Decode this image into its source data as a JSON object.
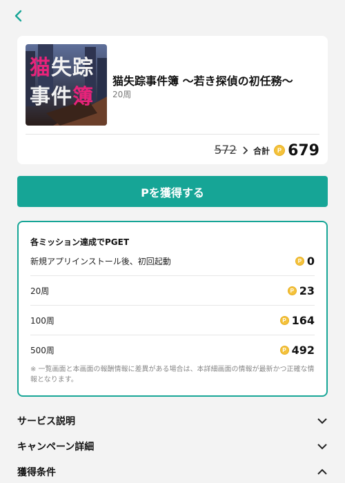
{
  "nav": {
    "back_icon": "chevron-left-icon"
  },
  "product": {
    "title": "猫失踪事件簿 〜若き探偵の初任務〜",
    "subtitle": "20周",
    "thumb_line1": [
      "猫",
      "失",
      "踪"
    ],
    "thumb_line2": [
      "事",
      "件",
      "簿"
    ],
    "old_price": "572",
    "total_label": "合計",
    "total": "679"
  },
  "cta": {
    "label": "Pを獲得する"
  },
  "mission": {
    "title": "各ミッション達成でPGET",
    "rows": [
      {
        "label": "新規アプリインストール後、初回起動",
        "value": "0"
      },
      {
        "label": "20周",
        "value": "23"
      },
      {
        "label": "100周",
        "value": "164"
      },
      {
        "label": "500周",
        "value": "492"
      }
    ],
    "note": "※ 一覧画面と本画面の報酬情報に差異がある場合は、本詳細画面の情報が最新かつ正確な情報となります。"
  },
  "coin_letter": "P",
  "accordions": [
    {
      "label": "サービス説明",
      "icon": "chevron-down-icon"
    },
    {
      "label": "キャンペーン詳細",
      "icon": "chevron-down-icon"
    },
    {
      "label": "獲得条件",
      "icon": "chevron-up-icon"
    }
  ],
  "colors": {
    "accent": "#16a596",
    "coin": "#f4c23b",
    "thumb_pink": "#e8237a"
  }
}
